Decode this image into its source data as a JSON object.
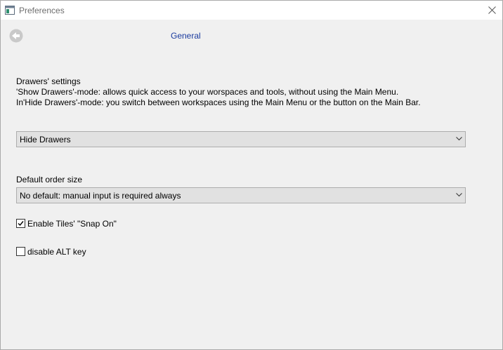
{
  "window": {
    "title": "Preferences",
    "close_icon": "close-icon",
    "app_icon": "window-app-icon"
  },
  "header": {
    "back_icon": "back-arrow-icon",
    "title": "General"
  },
  "drawers": {
    "title": "Drawers' settings",
    "desc_line1": "'Show Drawers'-mode:  allows quick access to your worspaces and tools, without using the Main Menu.",
    "desc_line2": "In'Hide Drawers'-mode: you switch between workspaces using the Main Menu or the button on the Main Bar.",
    "selected": "Hide Drawers"
  },
  "order_size": {
    "label": "Default order size",
    "selected": "No default: manual input is required always"
  },
  "options": {
    "snap_label": "Enable Tiles' \"Snap On\"",
    "snap_checked": true,
    "alt_label": "disable ALT key",
    "alt_checked": false
  },
  "colors": {
    "background": "#f0f0f0",
    "titlebar": "#ffffff",
    "header_link": "#1a3a9e",
    "combo_bg": "#e1e1e1"
  }
}
